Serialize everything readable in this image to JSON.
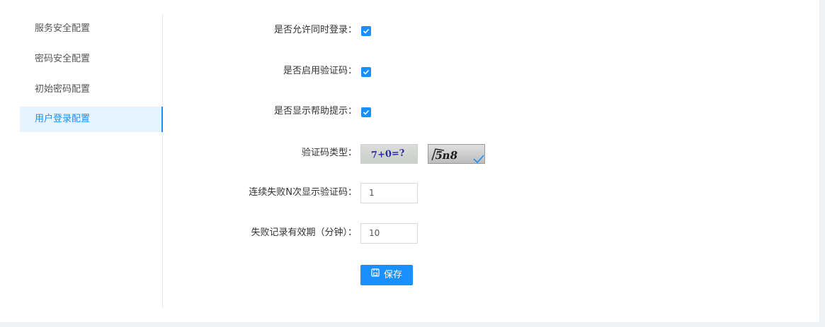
{
  "sidebar": {
    "items": [
      {
        "label": "服务安全配置"
      },
      {
        "label": "密码安全配置"
      },
      {
        "label": "初始密码配置"
      },
      {
        "label": "用户登录配置"
      }
    ]
  },
  "form": {
    "concurrent_login": {
      "label": "是否允许同时登录：",
      "checked": true
    },
    "enable_captcha": {
      "label": "是否启用验证码：",
      "checked": true
    },
    "show_help": {
      "label": "是否显示帮助提示：",
      "checked": true
    },
    "captcha_type": {
      "label": "验证码类型：",
      "option1_text": "7+0=?",
      "option2_text": "5n8",
      "selected": 2
    },
    "fail_count": {
      "label": "连续失败N次显示验证码：",
      "value": "1"
    },
    "fail_period": {
      "label": "失败记录有效期（分钟）：",
      "value": "10"
    },
    "save_label": "保存"
  },
  "colors": {
    "accent": "#1890ff",
    "active_bg": "#e6f4ff"
  }
}
